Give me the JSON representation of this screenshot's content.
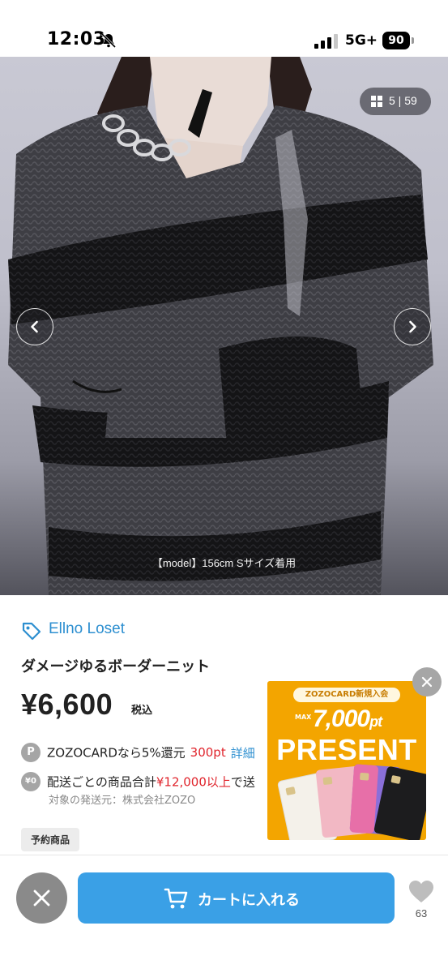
{
  "status_bar": {
    "time": "12:03",
    "network": "5G+",
    "battery": "90"
  },
  "gallery": {
    "counter": "5 | 59",
    "caption": "【model】156cm Sサイズ着用"
  },
  "product": {
    "brand": "Ellno Loset",
    "name": "ダメージゆるボーダーニット",
    "price": "¥6,600",
    "tax_label": "税込",
    "points": {
      "badge": "P",
      "text": "ZOZOCARDなら5%還元",
      "amount": "300pt",
      "detail_link": "詳細"
    },
    "shipping": {
      "badge": "¥0",
      "text": "配送ごとの商品合計",
      "amount": "¥12,000以上",
      "tail": "で送",
      "origin": "対象の発送元：株式会社ZOZO"
    },
    "tag": "予約商品"
  },
  "promo": {
    "label": "ZOZOCARD新規入会",
    "max": "MAX",
    "amount": "7,000",
    "unit": "pt",
    "headline": "PRESENT"
  },
  "bottom_bar": {
    "cart_label": "カートに入れる",
    "favorite_count": "63"
  },
  "colors": {
    "accent_blue": "#3aa0e6",
    "brand_blue": "#2d8fd0",
    "sale_red": "#e0242c",
    "promo_orange": "#f3a500"
  },
  "icons": {
    "status": [
      "bell-slash-icon",
      "signal-icon",
      "battery-icon"
    ],
    "gallery": [
      "grid-icon",
      "chevron-left-icon",
      "chevron-right-icon"
    ],
    "product": [
      "tag-icon"
    ],
    "bottom": [
      "close-icon",
      "cart-icon",
      "heart-icon"
    ]
  }
}
